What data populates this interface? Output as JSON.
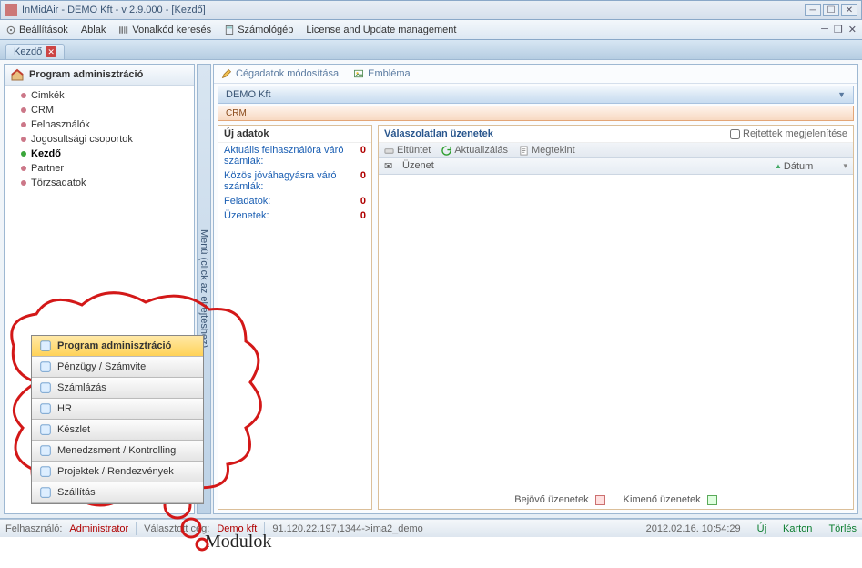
{
  "window": {
    "title": "InMidAir - DEMO Kft - v 2.9.000 - [Kezdő]"
  },
  "menu": {
    "settings": "Beállítások",
    "window": "Ablak",
    "barcode": "Vonalkód keresés",
    "calculator": "Számológép",
    "license": "License and Update management"
  },
  "tab": {
    "label": "Kezdő"
  },
  "sidebar": {
    "title": "Program adminisztráció",
    "items": [
      {
        "label": "Cimkék"
      },
      {
        "label": "CRM"
      },
      {
        "label": "Felhasználók"
      },
      {
        "label": "Jogosultsági csoportok"
      },
      {
        "label": "Kezdő",
        "selected": true,
        "green": true
      },
      {
        "label": "Partner"
      },
      {
        "label": "Törzsadatok"
      }
    ]
  },
  "vbar": "Menü (click az elrejtéshez)",
  "toolbar": {
    "edit": "Cégadatok módosítása",
    "logo": "Embléma"
  },
  "company": "DEMO Kft",
  "crm": {
    "band": "CRM",
    "newdata_title": "Új adatok",
    "items": [
      {
        "label": "Aktuális felhasználóra váró számlák:",
        "count": "0"
      },
      {
        "label": "Közös jóváhagyásra váró számlák:",
        "count": "0"
      },
      {
        "label": "Feladatok:",
        "count": "0"
      },
      {
        "label": "Üzenetek:",
        "count": "0"
      }
    ],
    "messages_title": "Válaszolatlan üzenetek",
    "show_hidden": "Rejtettek megjelenítése",
    "msg_toolbar": {
      "hide": "Eltüntet",
      "refresh": "Aktualizálás",
      "view": "Megtekint"
    },
    "cols": {
      "msg": "Üzenet",
      "date": "Dátum"
    },
    "legend_in": "Bejövő üzenetek",
    "legend_out": "Kimenő üzenetek"
  },
  "status": {
    "user_label": "Felhasználó:",
    "user": "Administrator",
    "company_label": "Választott cég:",
    "company": "Demo kft",
    "conn": "91.120.22.197,1344->ima2_demo",
    "datetime": "2012.02.16. 10:54:29",
    "new": "Új",
    "card": "Karton",
    "delete": "Törlés"
  },
  "modules": [
    "Program adminisztráció",
    "Pénzügy / Számvitel",
    "Számlázás",
    "HR",
    "Készlet",
    "Menedzsment / Kontrolling",
    "Projektek / Rendezvények",
    "Szállítás"
  ],
  "annotation": "Modulok"
}
